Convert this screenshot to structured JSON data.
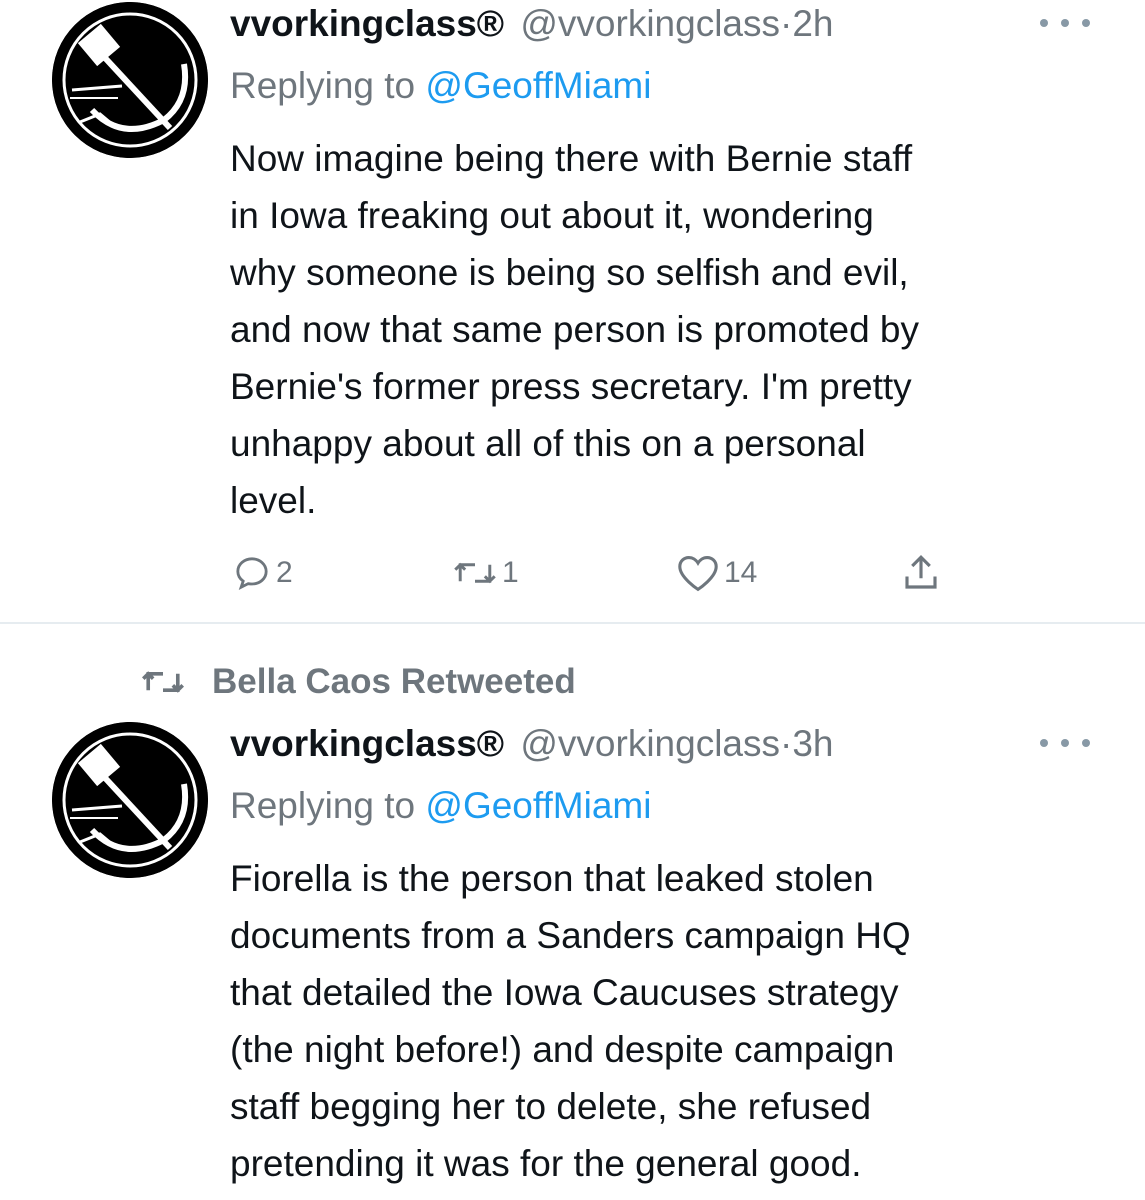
{
  "tweets": [
    {
      "display_name": "vvorkingclass®",
      "handle": "@vvorkingclass",
      "time_sep": "·",
      "time": "2h",
      "replying_prefix": "Replying to",
      "replying_handle": "@GeoffMiami",
      "text": "Now imagine being there with Bernie staff\nin Iowa freaking out about it, wondering\nwhy someone is being so selfish and evil,\nand now that same person is promoted by\nBernie's former press secretary. I'm pretty\nunhappy about all of this on a personal\nlevel.",
      "actions": {
        "replies": "2",
        "retweets": "1",
        "likes": "14"
      }
    },
    {
      "display_name": "vvorkingclass®",
      "handle": "@vvorkingclass",
      "time_sep": "·",
      "time": "3h",
      "replying_prefix": "Replying to",
      "replying_handle": "@GeoffMiami",
      "text": "Fiorella is the person that leaked stolen\ndocuments from a Sanders campaign HQ\nthat detailed the Iowa Caucuses strategy\n(the night before!) and despite campaign\nstaff begging her to delete, she refused\npretending it was for the general good."
    }
  ],
  "retweeted_by": "Bella Caos Retweeted",
  "icons": {
    "avatar": "hammer-and-sickle-icon",
    "more": "more-dots-icon",
    "reply": "reply-icon",
    "retweet": "retweet-icon",
    "like": "heart-icon",
    "share": "share-icon"
  },
  "colors": {
    "text": "#0f1419",
    "secondary": "#6e767d",
    "link": "#1d9bf0",
    "divider": "#e6ecf0"
  }
}
